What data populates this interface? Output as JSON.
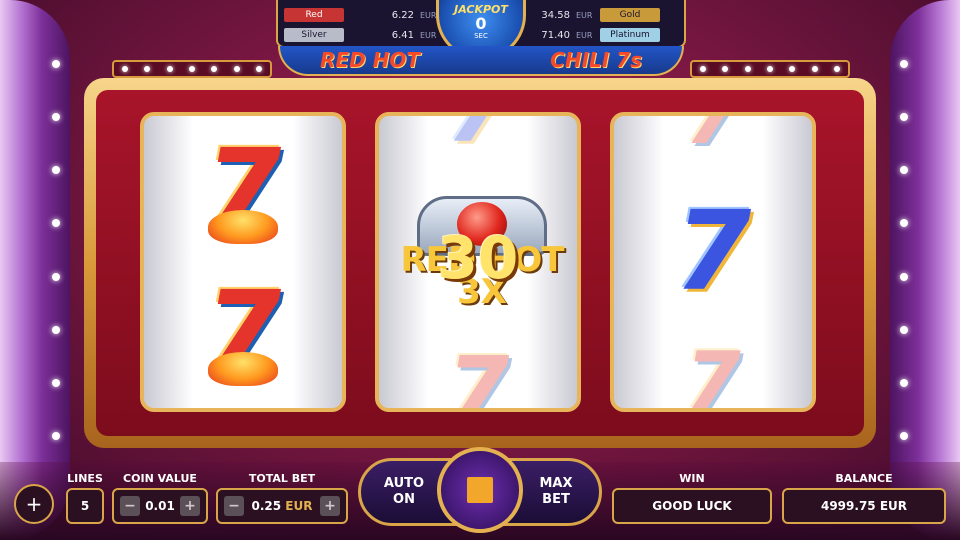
{
  "jackpots": {
    "red": {
      "label": "Red",
      "value": "6.22",
      "currency": "EUR",
      "color": "#c63434"
    },
    "silver": {
      "label": "Silver",
      "value": "6.41",
      "currency": "EUR",
      "color": "#b8bcc8"
    },
    "gold": {
      "label": "Gold",
      "value": "34.58",
      "currency": "EUR",
      "color": "#c99a3a"
    },
    "platinum": {
      "label": "Platinum",
      "value": "71.40",
      "currency": "EUR",
      "color": "#9fd0e6"
    },
    "timer_title": "JACKPOT",
    "timer_value": "0",
    "timer_unit": "SEC"
  },
  "logo": {
    "left": "RED HOT",
    "right": "CHILI 7s"
  },
  "bonus": {
    "countdown": "30",
    "badge_title": "RED HOT",
    "badge_multiplier": "3X"
  },
  "reels": [
    {
      "symbols": [
        "7",
        "7"
      ]
    },
    {
      "symbols": [
        "7",
        "7"
      ]
    },
    {
      "symbols": [
        "7",
        "7",
        "7"
      ]
    }
  ],
  "controls": {
    "lines_label": "LINES",
    "lines_value": "5",
    "coin_value_label": "COIN VALUE",
    "coin_value": "0.01",
    "total_bet_label": "TOTAL BET",
    "total_bet_value": "0.25",
    "total_bet_currency": "EUR",
    "auto_label_1": "AUTO",
    "auto_label_2": "ON",
    "max_label_1": "MAX",
    "max_label_2": "BET",
    "win_label": "WIN",
    "win_value": "GOOD LUCK",
    "balance_label": "BALANCE",
    "balance_value": "4999.75 EUR",
    "minus": "−",
    "plus": "+"
  }
}
